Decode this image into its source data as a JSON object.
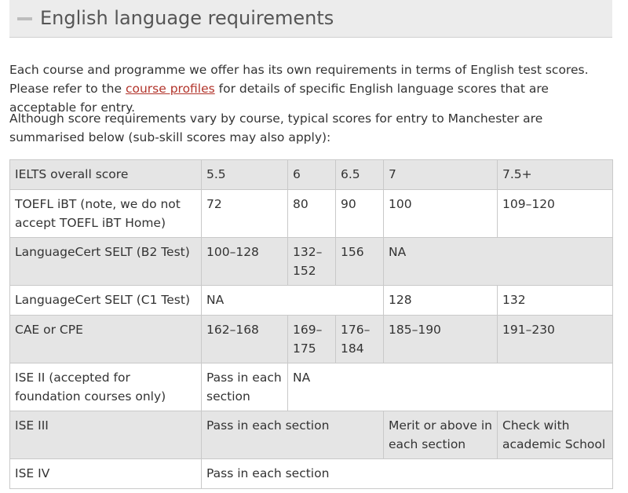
{
  "section": {
    "title": "English language requirements",
    "collapse_icon": "minus-icon"
  },
  "intro": {
    "p1_before": "Each course and programme we offer has its own requirements in terms of English test scores. Please refer to the ",
    "p1_link": "course profiles",
    "p1_after": " for details of specific English language scores that are acceptable for entry.",
    "p2": "Although score requirements vary by course, typical scores for entry to Manchester are summarised below (sub-skill scores may also apply):"
  },
  "table": {
    "rows": [
      {
        "label": "IELTS overall score",
        "cells": [
          "5.5",
          "6",
          "6.5",
          "7",
          "7.5+"
        ]
      },
      {
        "label": "TOEFL iBT (note, we do not accept TOEFL iBT Home)",
        "cells": [
          "72",
          "80",
          "90",
          "100",
          "109–120"
        ]
      },
      {
        "label": "LanguageCert SELT (B2 Test)",
        "cells": [
          "100–128",
          "132–152",
          "156",
          "NA"
        ]
      },
      {
        "label": "LanguageCert SELT (C1 Test)",
        "cells": [
          "NA",
          "128",
          "132"
        ]
      },
      {
        "label": "CAE or CPE",
        "cells": [
          "162–168",
          "169–175",
          "176–184",
          "185–190",
          "191–230"
        ]
      },
      {
        "label": "ISE II (accepted for foundation courses only)",
        "cells": [
          "Pass in each section",
          "NA"
        ]
      },
      {
        "label": "ISE III",
        "cells": [
          "Pass in each section",
          "Merit or above in each section",
          "Check with academic School"
        ]
      },
      {
        "label": "ISE IV",
        "cells": [
          "Pass in each section"
        ]
      }
    ]
  }
}
